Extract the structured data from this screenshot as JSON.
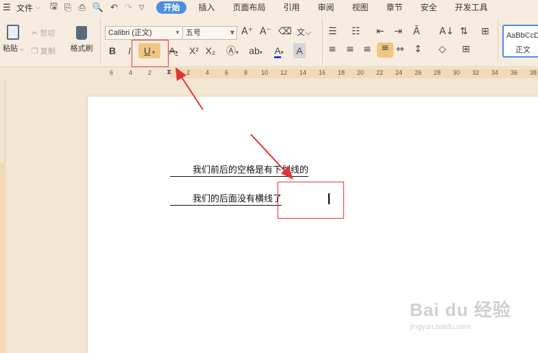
{
  "menubar": {
    "file_label": "文件",
    "tabs": [
      {
        "label": "开始",
        "active": true
      },
      {
        "label": "插入"
      },
      {
        "label": "页面布局"
      },
      {
        "label": "引用"
      },
      {
        "label": "审阅"
      },
      {
        "label": "视图"
      },
      {
        "label": "章节"
      },
      {
        "label": "安全"
      },
      {
        "label": "开发工具"
      }
    ]
  },
  "ribbon": {
    "paste_label": "粘贴",
    "cut_label": "剪切",
    "copy_label": "复制",
    "format_painter_label": "格式刷",
    "font_name": "Calibri (正文)",
    "font_size": "五号",
    "style_sample": "AaBbCcD",
    "style_name": "正文",
    "accent_color": "#4a8fe0",
    "highlight_color": "#f0c780"
  },
  "ruler": {
    "ticks": [
      "6",
      "4",
      "2",
      "2",
      "4",
      "6",
      "8",
      "10",
      "12",
      "14",
      "16",
      "18",
      "20",
      "22",
      "24",
      "26",
      "28",
      "30",
      "32",
      "34",
      "36",
      "38"
    ]
  },
  "document": {
    "line1": "        我们前后的空格是有下划线的",
    "line2": "        我们的后面没有横线了"
  },
  "watermark": {
    "brand": "Bai du 经验",
    "url": "jingyan.baidu.com"
  }
}
